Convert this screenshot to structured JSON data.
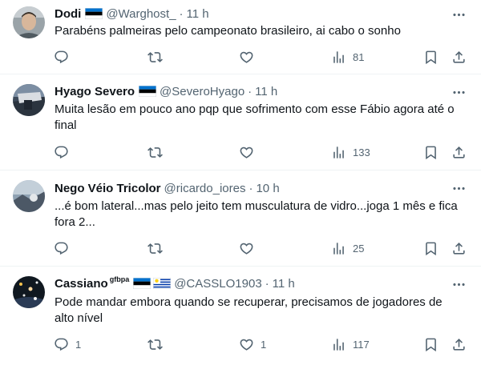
{
  "tweets": [
    {
      "name": "Dodi",
      "name_sup": "",
      "flags": [
        "estonia"
      ],
      "handle": "@Warghost_",
      "dot": "·",
      "time": "11 h",
      "text": "Parabéns palmeiras pelo campeonato brasileiro, ai cabo o sonho",
      "replies": "",
      "retweets": "",
      "likes": "",
      "views": "81"
    },
    {
      "name": "Hyago Severo",
      "name_sup": "",
      "flags": [
        "estonia"
      ],
      "handle": "@SeveroHyago",
      "dot": "·",
      "time": "11 h",
      "text": "Muita lesão em pouco ano pqp que sofrimento com esse Fábio agora até o\nfinal",
      "replies": "",
      "retweets": "",
      "likes": "",
      "views": "133"
    },
    {
      "name": "Nego Véio Tricolor",
      "name_sup": "",
      "flags": [],
      "handle": "@ricardo_iores",
      "dot": "·",
      "time": "10 h",
      "text": "...é bom lateral...mas pelo jeito tem musculatura de vidro...joga 1 mês e fica\nfora 2...",
      "replies": "",
      "retweets": "",
      "likes": "",
      "views": "25"
    },
    {
      "name": "Cassiano",
      "name_sup": "gfbpa",
      "flags": [
        "estonia",
        "uruguay"
      ],
      "handle": "@CASSLO1903",
      "dot": "·",
      "time": "11 h",
      "text": "Pode mandar embora quando se recuperar, precisamos de jogadores de\nalto nível",
      "replies": "1",
      "retweets": "",
      "likes": "1",
      "views": "117"
    }
  ],
  "colors": {
    "text": "#0f1419",
    "secondary": "#536471",
    "divider": "#eff3f4",
    "estonia_blue": "#0072ce",
    "uruguay_blue": "#0038a8",
    "uruguay_sun": "#fcd116"
  },
  "icons": {
    "reply": "speech-bubble-icon",
    "retweet": "retweet-arrows-icon",
    "like": "heart-icon",
    "views": "bar-chart-icon",
    "bookmark": "bookmark-icon",
    "share": "share-upload-icon",
    "more": "three-dots-icon"
  }
}
